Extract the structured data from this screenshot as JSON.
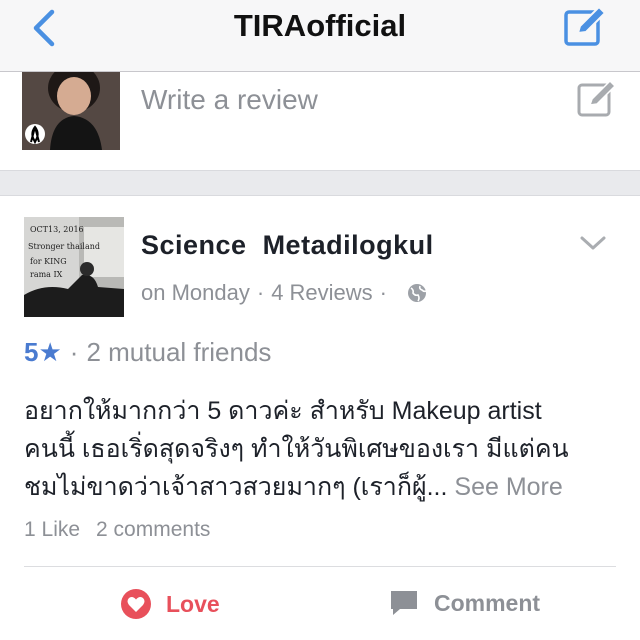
{
  "navbar": {
    "title": "TIRAofficial",
    "back_icon": "chevron-left-icon",
    "compose_icon": "compose-icon",
    "accent_color": "#4a90e2"
  },
  "review_prompt": {
    "placeholder": "Write a review",
    "edit_icon": "edit-icon"
  },
  "post": {
    "author": "Science  Metadilogkul",
    "time": "on Monday",
    "reviews": "4 Reviews",
    "privacy_icon": "globe-icon",
    "rating": "5★",
    "mutual_friends": "2 mutual friends",
    "body_lines": [
      "อยากให้มากกว่า 5 ดาวค่ะ สำหรับ Makeup artist",
      "คนนี้ เธอเริ่ดสุดจริงๆ ทำให้วันพิเศษของเรา มีแต่คน",
      "ชมไม่ขาดว่าเจ้าสาวสวยมากๆ (เราก็ผู้..."
    ],
    "see_more": "See More",
    "likes": "1 Like",
    "comments": "2 comments",
    "avatar_text": [
      "OCT13, 2016",
      "Stronger thailand",
      "for KING",
      "rama IX"
    ]
  },
  "actions": {
    "love_label": "Love",
    "love_color": "#e8505b",
    "comment_label": "Comment"
  }
}
